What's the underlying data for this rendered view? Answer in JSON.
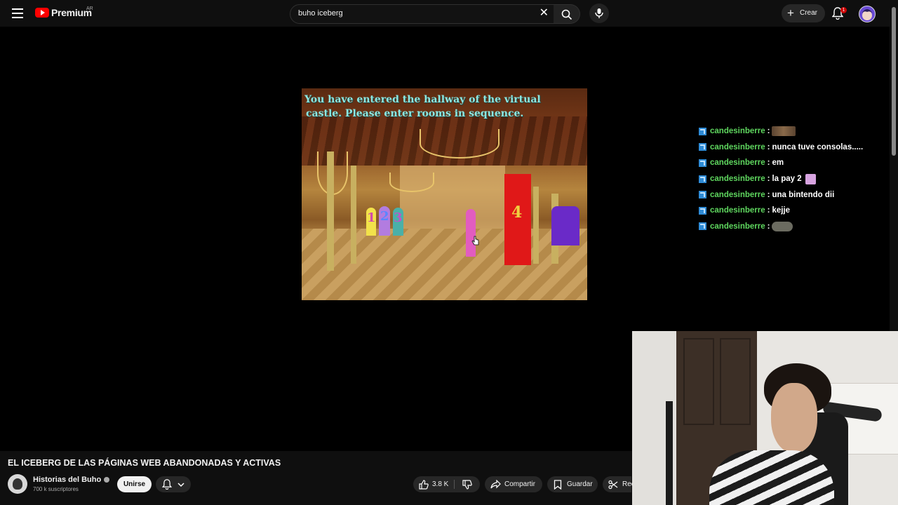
{
  "topbar": {
    "logo_text": "Premium",
    "region": "AR",
    "search_value": "buho iceberg",
    "create_label": "Crear",
    "notification_count": "1"
  },
  "video_frame": {
    "banner_line1": "You have entered the hallway of the virtual",
    "banner_line2": "castle. Please enter rooms in sequence.",
    "door_numbers": [
      "1",
      "2",
      "3",
      "4"
    ]
  },
  "chat": {
    "messages": [
      {
        "user": "candesinberre",
        "sep": ":",
        "text": "",
        "emote": "emote-faces"
      },
      {
        "user": "candesinberre",
        "sep": ":",
        "text": "nunca tuve consolas.....",
        "emote": ""
      },
      {
        "user": "candesinberre",
        "sep": ":",
        "text": "em",
        "emote": ""
      },
      {
        "user": "candesinberre",
        "sep": ":",
        "text": "la pay 2",
        "emote": "emote-pink"
      },
      {
        "user": "candesinberre",
        "sep": ":",
        "text": "una bintendo dii",
        "emote": ""
      },
      {
        "user": "candesinberre",
        "sep": ":",
        "text": "kejje",
        "emote": ""
      },
      {
        "user": "candesinberre",
        "sep": ":",
        "text": "",
        "emote": "emote-car"
      }
    ],
    "user_color": "#5fd75f"
  },
  "video": {
    "title": "EL ICEBERG DE LAS PÁGINAS WEB ABANDONADAS Y ACTIVAS",
    "channel_name": "Historias del Buho",
    "subscribers": "700 k suscriptores",
    "join_label": "Unirse",
    "likes": "3.8 K",
    "share_label": "Compartir",
    "save_label": "Guardar",
    "clip_label": "Rec"
  },
  "colors": {
    "background": "#0f0f0f",
    "brand_red": "#ff0000",
    "pill_bg": "#272727"
  }
}
